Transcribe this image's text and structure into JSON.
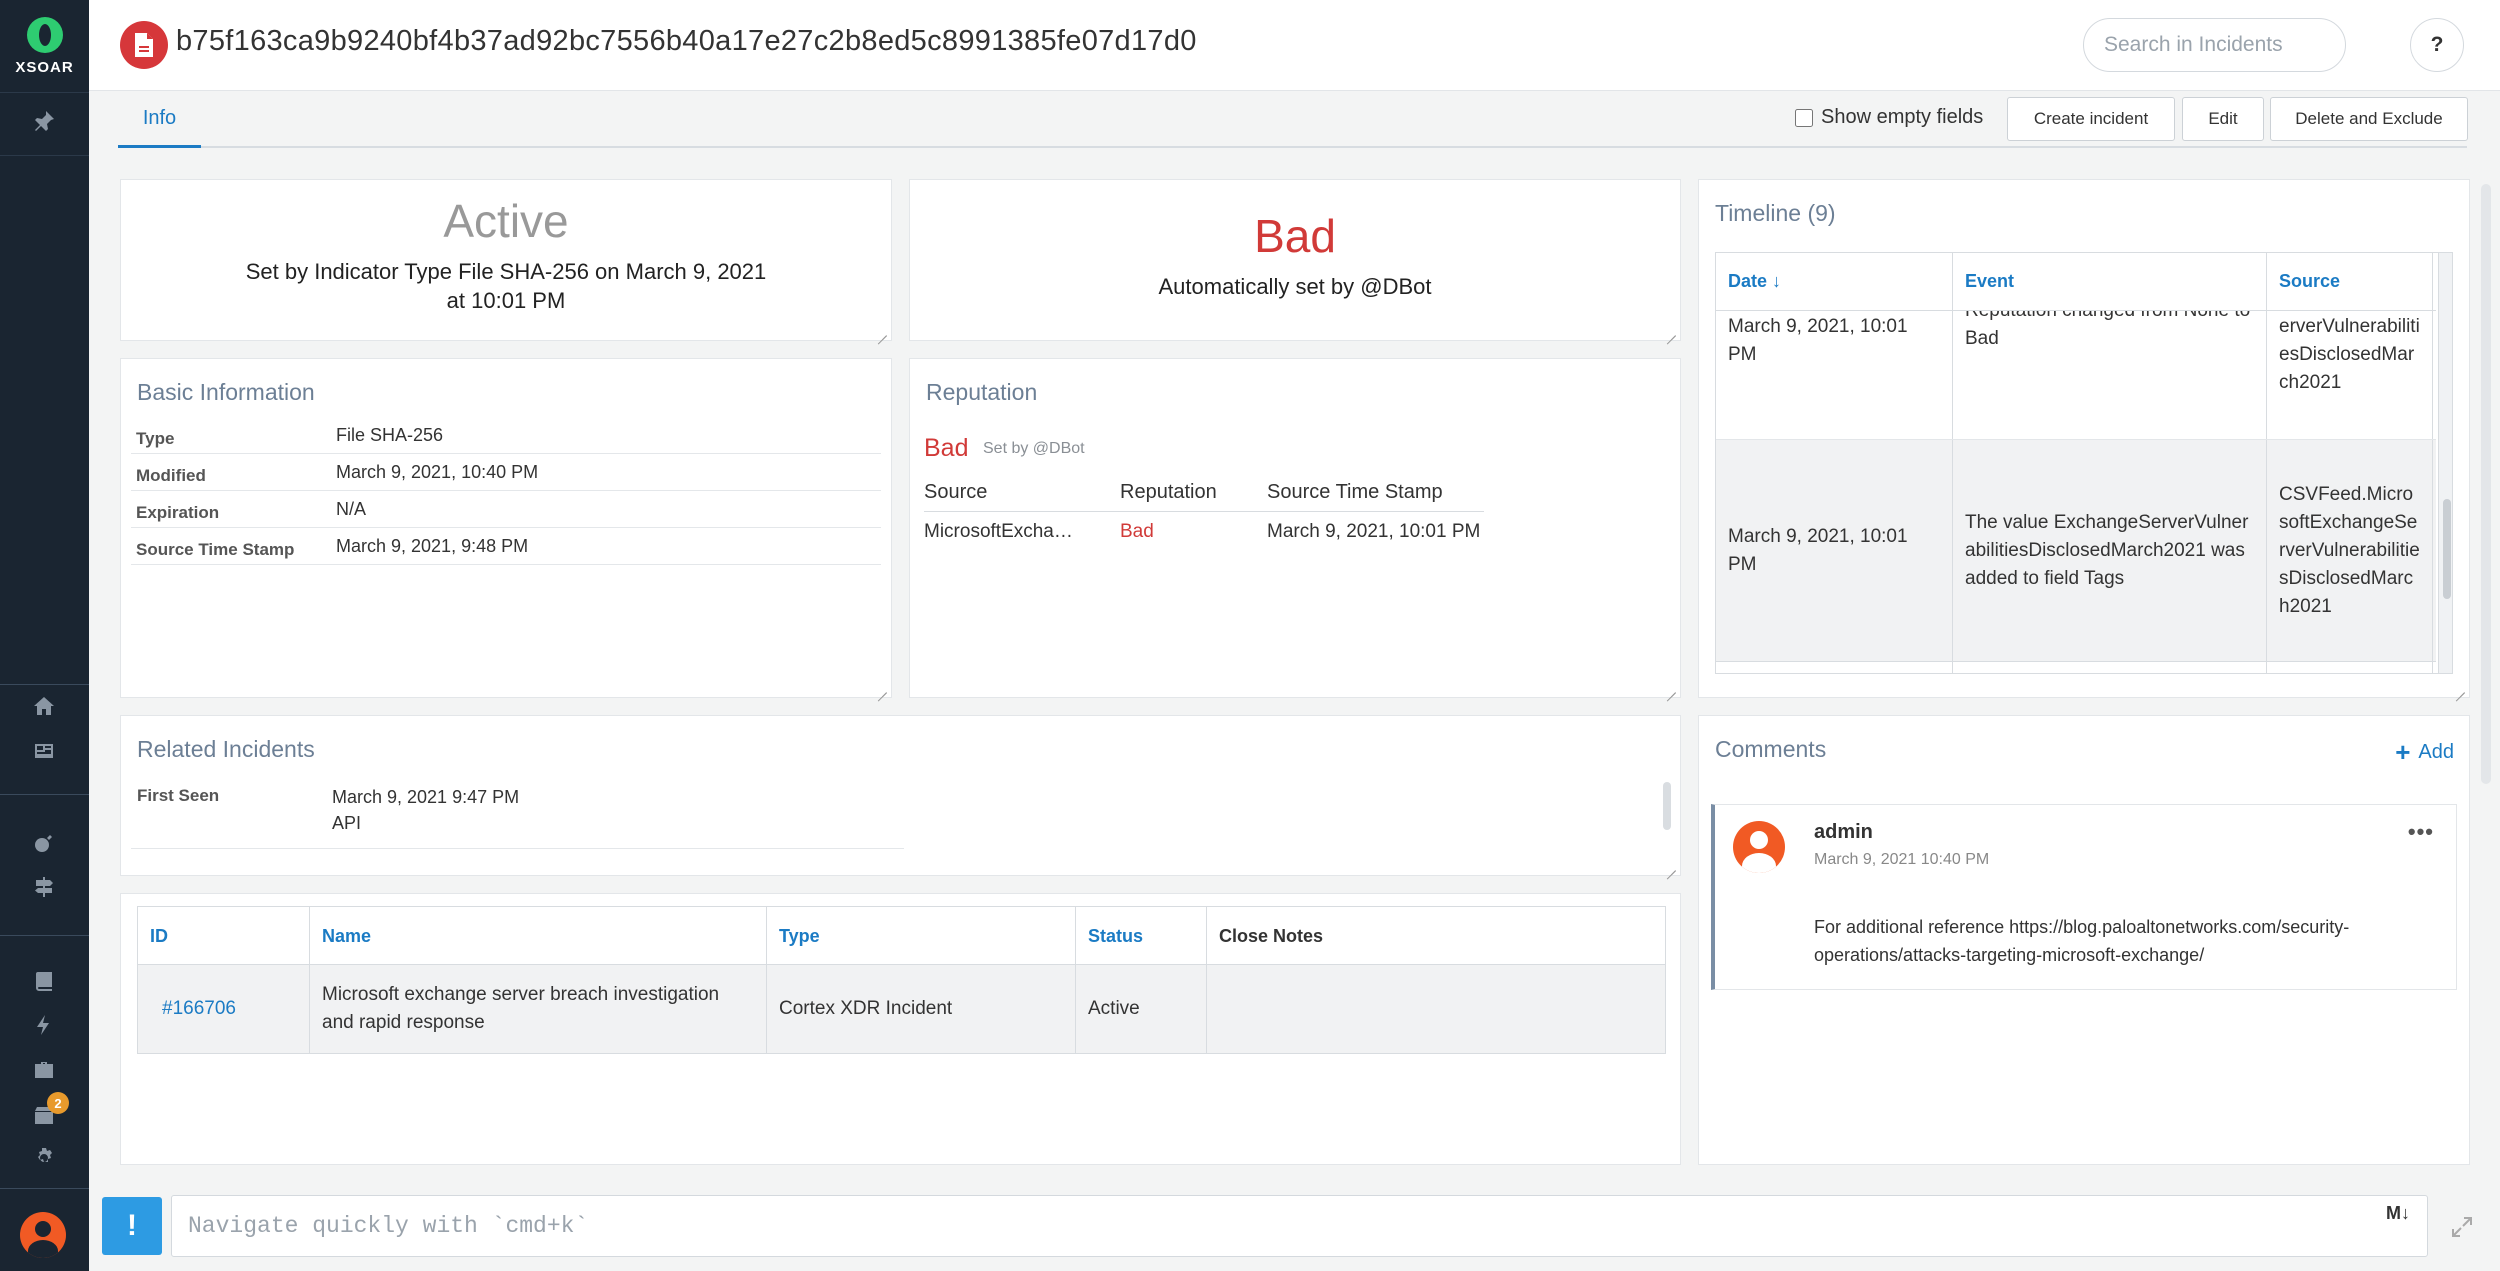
{
  "app": {
    "logo_text": "XSOAR",
    "notification_count": "2"
  },
  "header": {
    "title": "b75f163ca9b9240bf4b37ad92bc7556b40a17e27c2b8ed5c8991385fe07d17d0",
    "search_placeholder": "Search in Incidents",
    "help_label": "?"
  },
  "tabs": {
    "info": "Info"
  },
  "toolbar": {
    "show_empty": "Show empty fields",
    "create": "Create incident",
    "edit": "Edit",
    "delete": "Delete and Exclude"
  },
  "status": {
    "value": "Active",
    "line1": "Set by Indicator Type File SHA-256 on March 9, 2021",
    "line2": "at 10:01 PM"
  },
  "verdict": {
    "value": "Bad",
    "subtext": "Automatically set by @DBot",
    "color": "#d13a38"
  },
  "basic_info": {
    "title": "Basic Information",
    "rows": [
      {
        "key": "Type",
        "value": "File SHA-256"
      },
      {
        "key": "Modified",
        "value": "March 9, 2021, 10:40 PM"
      },
      {
        "key": "Expiration",
        "value": "N/A"
      },
      {
        "key": "Source Time Stamp",
        "value": "March 9, 2021, 9:48 PM"
      }
    ]
  },
  "reputation": {
    "title": "Reputation",
    "verdict": "Bad",
    "set_by": "Set by @DBot",
    "headers": [
      "Source",
      "Reputation",
      "Source Time Stamp"
    ],
    "row": {
      "source": "MicrosoftExcha…",
      "reputation": "Bad",
      "timestamp": "March 9, 2021, 10:01 PM"
    }
  },
  "timeline": {
    "title": "Timeline (9)",
    "headers": {
      "date": "Date ↓",
      "event": "Event",
      "source": "Source"
    },
    "rows": [
      {
        "date": "March 9, 2021, 10:01 PM",
        "event": "Reputation changed from None to Bad",
        "source": "erverVulnerabilitiesDisclosedMarch2021"
      },
      {
        "date": "March 9, 2021, 10:01 PM",
        "event": "The value ExchangeServerVulnerabilitiesDisclosedMarch2021 was added to field Tags",
        "source": "CSVFeed.MicrosoftExchangeServerVulnerabilitiesDisclosedMarch2021"
      }
    ]
  },
  "related": {
    "title": "Related Incidents",
    "first_seen_label": "First Seen",
    "first_seen_date": "March 9, 2021 9:47 PM",
    "first_seen_source": "API"
  },
  "incidents": {
    "headers": {
      "id": "ID",
      "name": "Name",
      "type": "Type",
      "status": "Status",
      "close_notes": "Close Notes"
    },
    "rows": [
      {
        "id": "#166706",
        "name": "Microsoft exchange server breach investigation and rapid response",
        "type": "Cortex XDR Incident",
        "status": "Active",
        "close_notes": ""
      }
    ]
  },
  "comments": {
    "title": "Comments",
    "add_label": "Add",
    "items": [
      {
        "user": "admin",
        "date": "March 9, 2021 10:40 PM",
        "text": "For additional reference https://blog.paloaltonetworks.com/security-operations/attacks-targeting-microsoft-exchange/"
      }
    ]
  },
  "command_bar": {
    "placeholder": "Navigate quickly with `cmd+k`",
    "alert_label": "!"
  },
  "colors": {
    "accent": "#1b7bc4",
    "bad": "#d13a38",
    "sidebar": "#1a2531",
    "active_status": "#999999"
  }
}
